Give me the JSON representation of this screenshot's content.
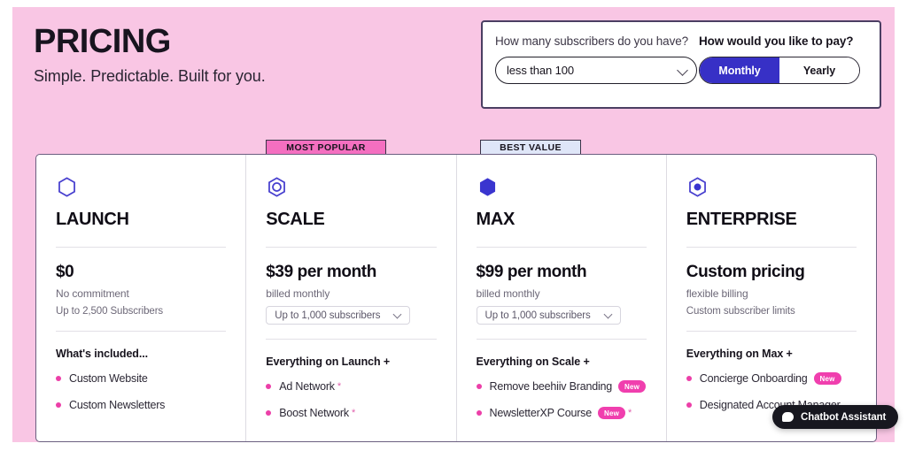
{
  "hero": {
    "title": "PRICING",
    "subtitle": "Simple. Predictable. Built for you."
  },
  "selector": {
    "subscribers_label": "How many subscribers do you have?",
    "subscribers_value": "less than 100",
    "pay_label": "How would you like to pay?",
    "monthly_label": "Monthly",
    "yearly_label": "Yearly",
    "active_billing": "Monthly"
  },
  "ribbons": {
    "most_popular": "MOST POPULAR",
    "best_value": "BEST VALUE"
  },
  "colors": {
    "hero_background": "#f9c6e4",
    "accent_blue": "#3730c6",
    "accent_pink": "#ec3fa8",
    "popular_badge": "#f46fc0",
    "value_badge": "#dfe6f8",
    "card_border": "#6b5f80"
  },
  "plans": [
    {
      "icon": "hexagon-outline-icon",
      "name": "LAUNCH",
      "price": "$0",
      "price_sub": "No commitment",
      "limit_type": "text",
      "limit_text": "Up to 2,500 Subscribers",
      "included_title": "What's included...",
      "features": [
        {
          "text": "Custom Website",
          "asterisk": false,
          "badge": ""
        },
        {
          "text": "Custom Newsletters",
          "asterisk": false,
          "badge": ""
        }
      ]
    },
    {
      "icon": "hexagon-ring-icon",
      "name": "SCALE",
      "price": "$39 per month",
      "price_sub": "billed monthly",
      "limit_type": "select",
      "limit_text": "Up to 1,000 subscribers",
      "included_title": "Everything on Launch +",
      "features": [
        {
          "text": "Ad Network",
          "asterisk": true,
          "badge": ""
        },
        {
          "text": "Boost Network",
          "asterisk": true,
          "badge": ""
        }
      ]
    },
    {
      "icon": "hexagon-solid-icon",
      "name": "MAX",
      "price": "$99 per month",
      "price_sub": "billed monthly",
      "limit_type": "select",
      "limit_text": "Up to 1,000 subscribers",
      "included_title": "Everything on Scale +",
      "features": [
        {
          "text": "Remove beehiiv Branding",
          "asterisk": false,
          "badge": "New"
        },
        {
          "text": "NewsletterXP Course",
          "asterisk": true,
          "badge": "New"
        }
      ]
    },
    {
      "icon": "hexagon-dot-icon",
      "name": "ENTERPRISE",
      "price": "Custom pricing",
      "price_sub": "flexible billing",
      "limit_type": "text",
      "limit_text": "Custom subscriber limits",
      "included_title": "Everything on Max +",
      "features": [
        {
          "text": "Concierge Onboarding",
          "asterisk": false,
          "badge": "New"
        },
        {
          "text": "Designated Account Manager",
          "asterisk": false,
          "badge": ""
        }
      ]
    }
  ],
  "chatbot": {
    "label": "Chatbot Assistant"
  }
}
